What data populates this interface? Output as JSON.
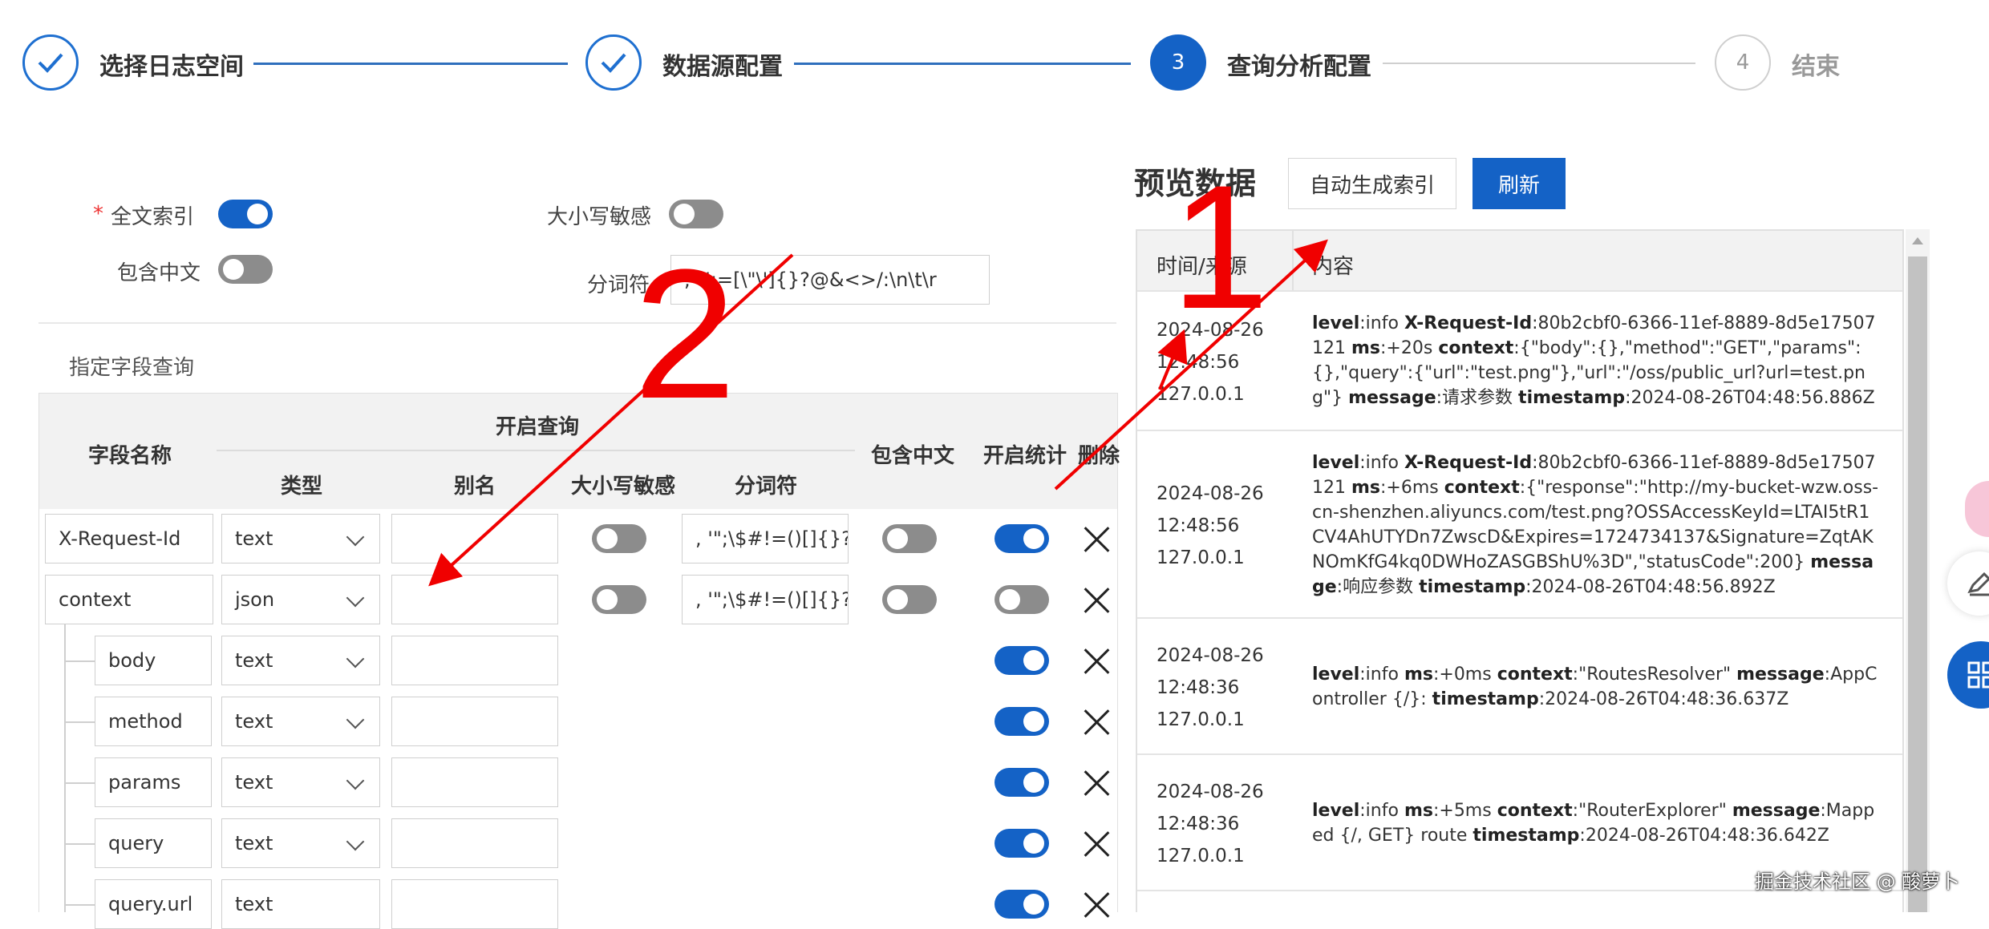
{
  "steps": [
    {
      "label": "选择日志空间",
      "state": "done"
    },
    {
      "label": "数据源配置",
      "state": "done"
    },
    {
      "number": "3",
      "label": "查询分析配置",
      "state": "active"
    },
    {
      "number": "4",
      "label": "结束",
      "state": "wait"
    }
  ],
  "settings": {
    "fulltext_required": "*",
    "fulltext_label": "全文索引",
    "fulltext_enabled": true,
    "case_sensitive_label": "大小写敏感",
    "case_sensitive_enabled": false,
    "chinese_label": "包含中文",
    "chinese_enabled": false,
    "tokenizer_label": "分词符",
    "tokenizer_value": ", '\";=[\\\"\\']{}?@&<>/:\\n\\t\\r"
  },
  "field_section_title": "指定字段查询",
  "table": {
    "headers": {
      "field_name": "字段名称",
      "enable_query": "开启查询",
      "type": "类型",
      "alias": "别名",
      "case_sensitive": "大小写敏感",
      "tokenizer": "分词符",
      "include_chinese": "包含中文",
      "enable_stats": "开启统计",
      "delete": "删除"
    },
    "rows": [
      {
        "name": "X-Request-Id",
        "type": "text",
        "alias": "",
        "case": false,
        "tokenizer": ", '\";\\$#!=()[]{}?@&",
        "chinese": false,
        "stats": true,
        "child": false
      },
      {
        "name": "context",
        "type": "json",
        "alias": "",
        "case": false,
        "tokenizer": ", '\";\\$#!=()[]{}?@&",
        "chinese": false,
        "stats": false,
        "child": false
      },
      {
        "name": "body",
        "type": "text",
        "alias": "",
        "stats": true,
        "child": true
      },
      {
        "name": "method",
        "type": "text",
        "alias": "",
        "stats": true,
        "child": true
      },
      {
        "name": "params",
        "type": "text",
        "alias": "",
        "stats": true,
        "child": true
      },
      {
        "name": "query",
        "type": "text",
        "alias": "",
        "stats": true,
        "child": true
      },
      {
        "name": "query.url",
        "type": "text",
        "alias": "",
        "stats": true,
        "child": true
      }
    ]
  },
  "preview": {
    "title": "预览数据",
    "auto_index_button": "自动生成索引",
    "refresh_button": "刷新",
    "col_time": "时间/来源",
    "col_content": "内容",
    "rows": [
      {
        "date": "2024-08-26",
        "time": "12:48:56",
        "source": "127.0.0.1",
        "parts": [
          [
            "level",
            ":info  "
          ],
          [
            "X-Request-Id",
            ":80b2cbf0-6366-11ef-8889-8d5e17507121  "
          ],
          [
            "ms",
            ":+20s  "
          ],
          [
            "context",
            ":{\"body\":{},\"method\":\"GET\",\"params\":{},\"query\":{\"url\":\"test.png\"},\"url\":\"/oss/public_url?url=test.png\"}  "
          ],
          [
            "message",
            ":请求参数  "
          ],
          [
            "timestamp",
            ":2024-08-26T04:48:56.886Z"
          ]
        ]
      },
      {
        "date": "2024-08-26",
        "time": "12:48:56",
        "source": "127.0.0.1",
        "parts": [
          [
            "level",
            ":info  "
          ],
          [
            "X-Request-Id",
            ":80b2cbf0-6366-11ef-8889-8d5e17507121  "
          ],
          [
            "ms",
            ":+6ms  "
          ],
          [
            "context",
            ":{\"response\":\"http://my-bucket-wzw.oss-cn-shenzhen.aliyuncs.com/test.png?OSSAccessKeyId=LTAI5tR1CV4AhUTYDn7ZwscD&Expires=1724734137&Signature=ZqtAKNOmKfG4kq0DWHoZASGBShU%3D\",\"statusCode\":200}  "
          ],
          [
            "message",
            ":响应参数  "
          ],
          [
            "timestamp",
            ":2024-08-26T04:48:56.892Z"
          ]
        ]
      },
      {
        "date": "2024-08-26",
        "time": "12:48:36",
        "source": "127.0.0.1",
        "parts": [
          [
            "level",
            ":info  "
          ],
          [
            "ms",
            ":+0ms  "
          ],
          [
            "context",
            ":\"RoutesResolver\"  "
          ],
          [
            "message",
            ":AppController {/}:  "
          ],
          [
            "timestamp",
            ":2024-08-26T04:48:36.637Z"
          ]
        ]
      },
      {
        "date": "2024-08-26",
        "time": "12:48:36",
        "source": "127.0.0.1",
        "parts": [
          [
            "level",
            ":info  "
          ],
          [
            "ms",
            ":+5ms  "
          ],
          [
            "context",
            ":\"RouterExplorer\"  "
          ],
          [
            "message",
            ":Mapped {/, GET} route  "
          ],
          [
            "timestamp",
            ":2024-08-26T04:48:36.642Z"
          ]
        ]
      }
    ]
  },
  "annotations": {
    "mark1": "1",
    "mark2": "2",
    "color": "#f00000"
  },
  "watermark": "掘金技术社区 @ 酸萝卜",
  "colors": {
    "primary": "#1462c6",
    "line": "#2f6fbd"
  }
}
